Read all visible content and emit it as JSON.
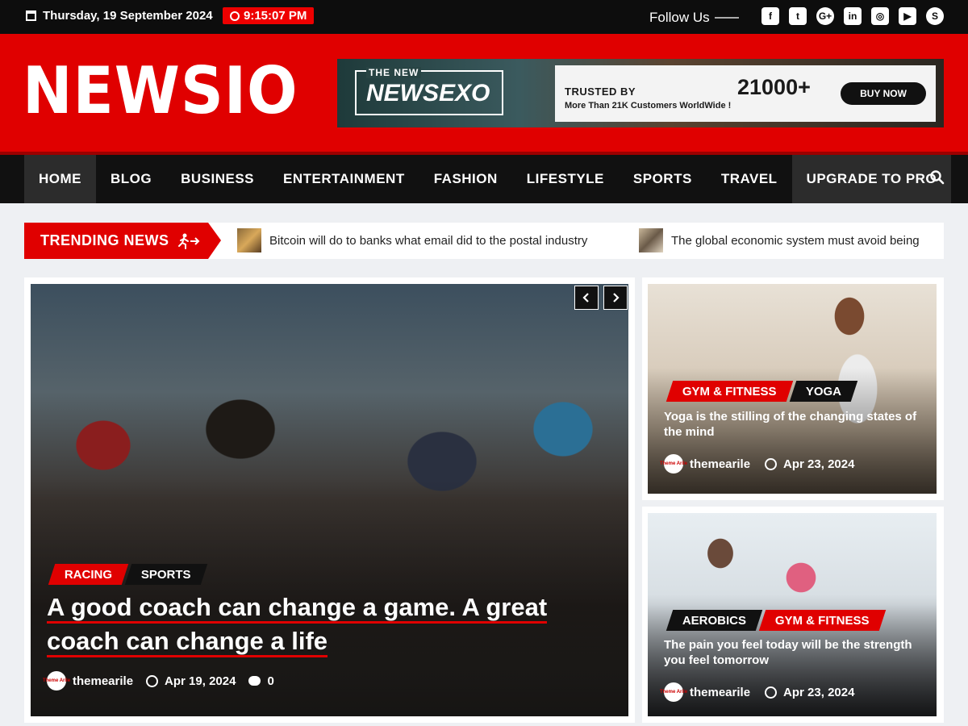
{
  "topbar": {
    "date": "Thursday, 19 September 2024",
    "time": "9:15:07 PM",
    "follow_label": "Follow Us",
    "socials": [
      {
        "icon": "facebook-icon",
        "glyph": "f"
      },
      {
        "icon": "twitter-icon",
        "glyph": "t"
      },
      {
        "icon": "google-plus-icon",
        "glyph": "G+"
      },
      {
        "icon": "linkedin-icon",
        "glyph": "in"
      },
      {
        "icon": "instagram-icon",
        "glyph": "◎"
      },
      {
        "icon": "youtube-icon",
        "glyph": "▶"
      },
      {
        "icon": "skype-icon",
        "glyph": "S"
      }
    ]
  },
  "header": {
    "logo": "NEWSIO",
    "banner": {
      "small": "THE NEW",
      "big": "NEWSEXO",
      "trusted": "TRUSTED BY",
      "trusted_sub": "More Than 21K Customers WorldWide !",
      "count": "21000+",
      "button": "BUY NOW"
    }
  },
  "nav": {
    "items": [
      "HOME",
      "BLOG",
      "BUSINESS",
      "ENTERTAINMENT",
      "FASHION",
      "LIFESTYLE",
      "SPORTS",
      "TRAVEL",
      "UPGRADE TO PRO"
    ]
  },
  "trending": {
    "label": "TRENDING NEWS",
    "items": [
      "Bitcoin will do to banks what email did to the postal industry",
      "The global economic system must avoid being"
    ]
  },
  "main_post": {
    "tags": [
      "RACING",
      "SPORTS"
    ],
    "title": "A good coach can change a game. A great coach can change a life",
    "author": "themearile",
    "date": "Apr 19, 2024",
    "comments": "0",
    "avatar_text": "Theme Arile"
  },
  "side_posts": [
    {
      "tags": [
        "GYM & FITNESS",
        "YOGA"
      ],
      "title": "Yoga is the stilling of the changing states of the mind",
      "author": "themearile",
      "date": "Apr 23, 2024"
    },
    {
      "tags": [
        "AEROBICS",
        "GYM & FITNESS"
      ],
      "title": "The pain you feel today will be the strength you feel tomorrow",
      "author": "themearile",
      "date": "Apr 23, 2024"
    }
  ],
  "colors": {
    "accent": "#e00000",
    "dark": "#111111"
  }
}
